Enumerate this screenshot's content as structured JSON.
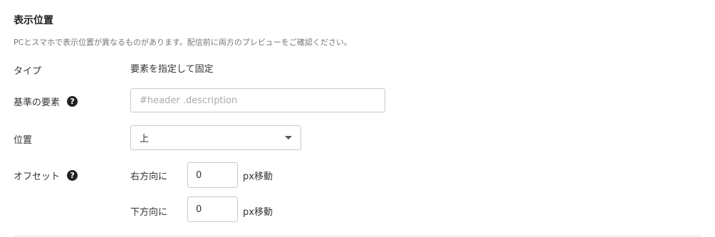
{
  "section": {
    "title": "表示位置",
    "description": "PCとスマホで表示位置が異なるものがあります。配信前に両方のプレビューをご確認ください。"
  },
  "fields": {
    "type": {
      "label": "タイプ",
      "value": "要素を指定して固定"
    },
    "base_element": {
      "label": "基準の要素",
      "help_icon": "?",
      "placeholder": "#header .description",
      "value": ""
    },
    "position": {
      "label": "位置",
      "selected": "上"
    },
    "offset": {
      "label": "オフセット",
      "help_icon": "?",
      "right": {
        "direction_label": "右方向に",
        "value": "0",
        "unit": "px移動"
      },
      "down": {
        "direction_label": "下方向に",
        "value": "0",
        "unit": "px移動"
      }
    }
  }
}
